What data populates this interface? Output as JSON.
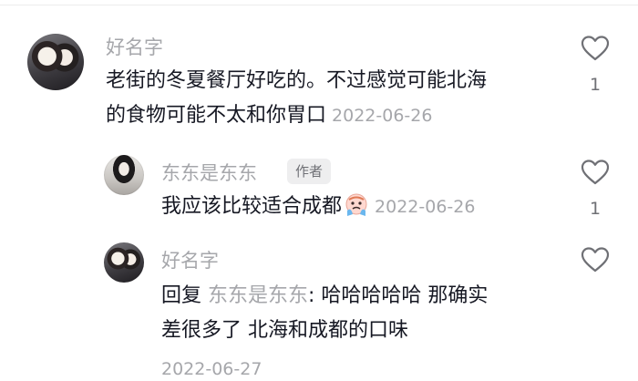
{
  "comments": [
    {
      "username": "好名字",
      "text": "老街的冬夏餐厅好吃的。不过感觉可能北海的食物可能不太和你胃口",
      "text_line1": "老街的冬夏餐厅好吃的。不过感觉可能北海",
      "text_line2": "的食物可能不太和你胃口",
      "date": "2022-06-26",
      "likes": "1"
    },
    {
      "username": "东东是东东",
      "author_tag": "作者",
      "text": "我应该比较适合成都",
      "emoji": "crying-face-emoji",
      "date": "2022-06-26",
      "likes": "1"
    },
    {
      "username": "好名字",
      "reply_prefix": "回复",
      "reply_to": "东东是东东",
      "text_line1": ": 哈哈哈哈哈 那确实",
      "text_line2": "差很多了 北海和成都的口味",
      "date": "2022-06-27"
    }
  ],
  "icons": {
    "like": "heart-outline-icon"
  },
  "colors": {
    "text_primary": "#161823",
    "text_secondary": "#a6a7ab",
    "tag_bg": "#eeeeef"
  }
}
